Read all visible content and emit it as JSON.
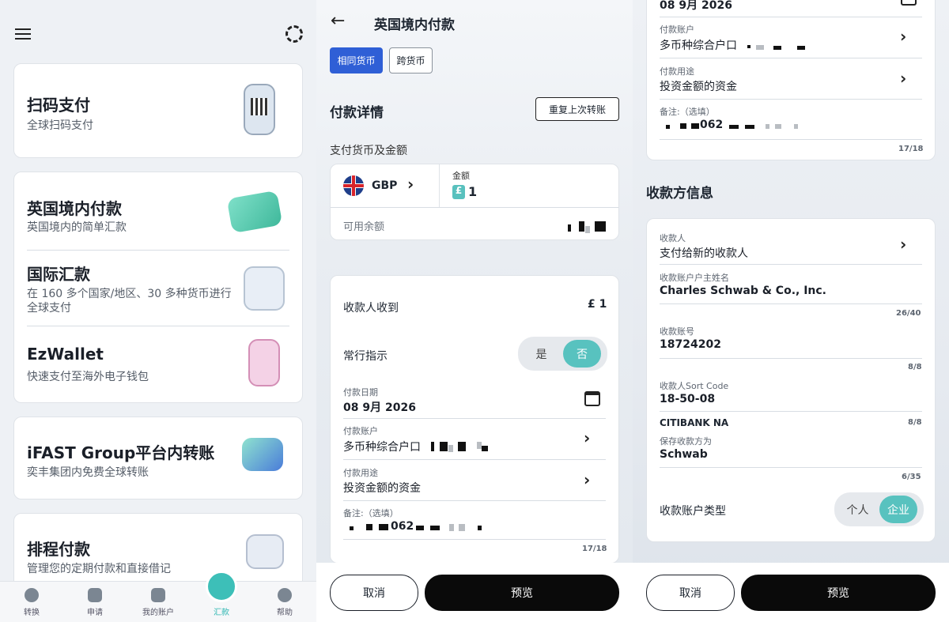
{
  "home": {
    "services": [
      {
        "title": "扫码支付",
        "desc": "全球扫码支付"
      },
      {
        "title": "英国境内付款",
        "desc": "英国境内的简单汇款"
      },
      {
        "title": "国际汇款",
        "desc_line1": "在 160 多个国家/地区、30 多种货币进行",
        "desc_line2": "全球支付"
      },
      {
        "title": "EzWallet",
        "desc": "快速支付至海外电子钱包"
      },
      {
        "title": "iFAST Group平台内转账",
        "desc": "奕丰集团内免费全球转账"
      },
      {
        "title": "排程付款",
        "desc": "管理您的定期付款和直接借记"
      }
    ],
    "nav": [
      {
        "label": "转换",
        "icon": "convert-icon"
      },
      {
        "label": "申请",
        "icon": "apply-icon"
      },
      {
        "label": "我的账户",
        "icon": "wallet-icon"
      },
      {
        "label": "汇款",
        "icon": "remit-icon"
      },
      {
        "label": "帮助",
        "icon": "help-icon"
      }
    ]
  },
  "transfer": {
    "title": "英国境内付款",
    "tab_same": "相同货币",
    "tab_cross": "跨货币",
    "section_title": "付款详情",
    "repeat_button": "重复上次转账",
    "currency_amount_label": "支付货币及金额",
    "currency": "GBP",
    "amount_label": "金额",
    "currency_symbol": "£",
    "amount": "1",
    "available_balance_label": "可用余额",
    "recipient_receives_label": "收款人收到",
    "recipient_receives_value": "£ 1",
    "standing_order_label": "常行指示",
    "yes": "是",
    "no": "否",
    "payment_date_label": "付款日期",
    "payment_date": "08 9月 2026",
    "payment_account_label": "付款账户",
    "payment_account": "多币种综合户口",
    "payment_purpose_label": "付款用途",
    "payment_purpose": "投资金额的资金",
    "remark_label": "备注:（选填）",
    "remark_value": "062",
    "remark_counter": "17/18",
    "cancel": "取消",
    "preview": "预览"
  },
  "payee": {
    "top_date": "08 9月 2026",
    "payment_account_label": "付款账户",
    "payment_account": "多币种综合户口",
    "payment_purpose_label": "付款用途",
    "payment_purpose": "投资金额的资金",
    "remark_label": "备注:（选填）",
    "remark_value": "062",
    "remark_counter": "17/18",
    "section_title": "收款方信息",
    "payee_label": "收款人",
    "payee_value": "支付给新的收款人",
    "holder_label": "收款账户户主姓名",
    "holder_value": "Charles Schwab & Co., Inc.",
    "holder_counter": "26/40",
    "account_no_label": "收款账号",
    "account_no_value": "18724202",
    "account_no_counter": "8/8",
    "sort_code_label": "收款人Sort Code",
    "sort_code_value": "18-50-08",
    "bank_name": "CITIBANK NA",
    "sort_code_counter": "8/8",
    "save_as_label": "保存收款方为",
    "save_as_value": "Schwab",
    "save_as_counter": "6/35",
    "account_type_label": "收款账户类型",
    "individual": "个人",
    "business": "企业",
    "cancel": "取消",
    "preview": "预览"
  }
}
